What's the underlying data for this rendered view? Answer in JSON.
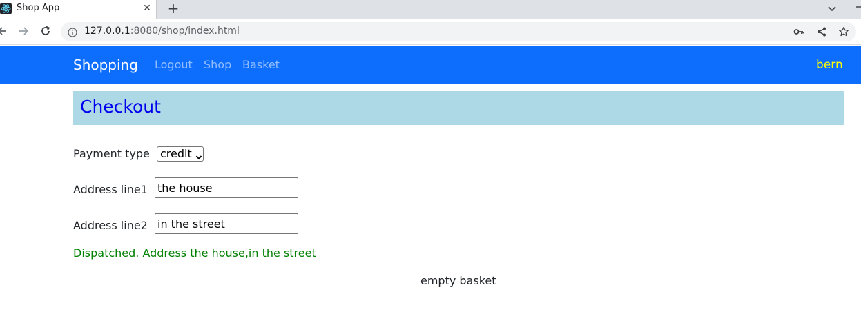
{
  "browser": {
    "tab_title": "Shop App",
    "tab_close": "✕",
    "new_tab": "+",
    "url_host": "127.0.0.1",
    "url_rest": ":8080/shop/index.html"
  },
  "navbar": {
    "brand": "Shopping",
    "links": [
      "Logout",
      "Shop",
      "Basket"
    ],
    "user": "bern"
  },
  "checkout": {
    "title": "Checkout",
    "payment_label": "Payment type",
    "payment_selected": "credit",
    "address1_label": "Address line1",
    "address1_value": "the house",
    "address2_label": "Address line2",
    "address2_value": "in the street",
    "status_message": "Dispatched. Address the house,in the street",
    "basket_message": "empty basket"
  },
  "colors": {
    "navbar_bg": "#0d6efd",
    "header_bg": "#add8e6",
    "title_color": "#0000ee",
    "user_color": "#ffff00",
    "status_color": "#008000"
  }
}
